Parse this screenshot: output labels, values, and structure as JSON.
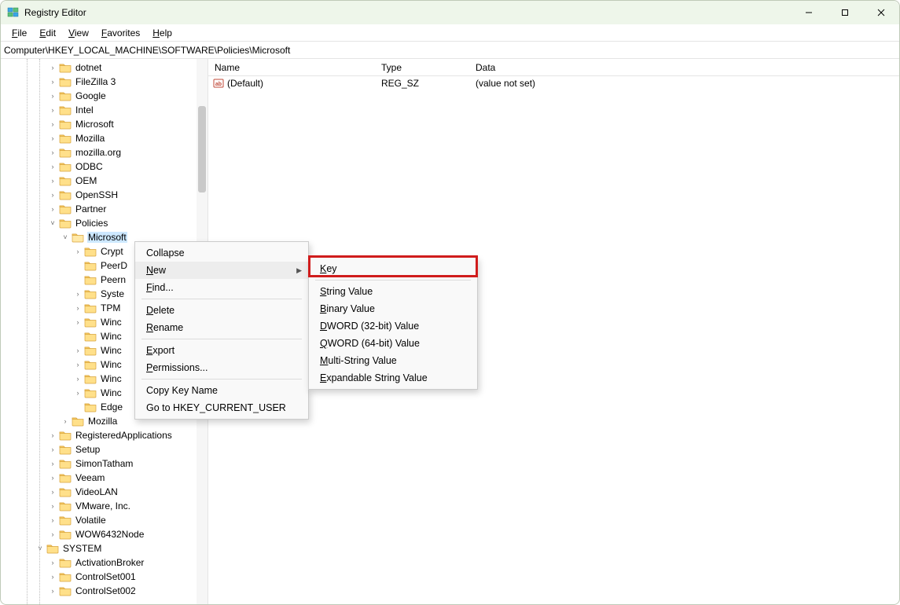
{
  "window": {
    "title": "Registry Editor"
  },
  "menubar": [
    "File",
    "Edit",
    "View",
    "Favorites",
    "Help"
  ],
  "address": "Computer\\HKEY_LOCAL_MACHINE\\SOFTWARE\\Policies\\Microsoft",
  "tree": {
    "items": [
      {
        "indent": 60,
        "chevron": ">",
        "label": "dotnet"
      },
      {
        "indent": 60,
        "chevron": ">",
        "label": "FileZilla 3"
      },
      {
        "indent": 60,
        "chevron": ">",
        "label": "Google"
      },
      {
        "indent": 60,
        "chevron": ">",
        "label": "Intel"
      },
      {
        "indent": 60,
        "chevron": ">",
        "label": "Microsoft"
      },
      {
        "indent": 60,
        "chevron": ">",
        "label": "Mozilla"
      },
      {
        "indent": 60,
        "chevron": ">",
        "label": "mozilla.org"
      },
      {
        "indent": 60,
        "chevron": ">",
        "label": "ODBC"
      },
      {
        "indent": 60,
        "chevron": ">",
        "label": "OEM"
      },
      {
        "indent": 60,
        "chevron": ">",
        "label": "OpenSSH"
      },
      {
        "indent": 60,
        "chevron": ">",
        "label": "Partner"
      },
      {
        "indent": 60,
        "chevron": "v",
        "label": "Policies"
      },
      {
        "indent": 76,
        "chevron": "v",
        "label": "Microsoft",
        "selected": true,
        "open": true
      },
      {
        "indent": 92,
        "chevron": ">",
        "label": "Crypt"
      },
      {
        "indent": 92,
        "chevron": "",
        "label": "PeerD"
      },
      {
        "indent": 92,
        "chevron": "",
        "label": "Peern"
      },
      {
        "indent": 92,
        "chevron": ">",
        "label": "Syste"
      },
      {
        "indent": 92,
        "chevron": ">",
        "label": "TPM"
      },
      {
        "indent": 92,
        "chevron": ">",
        "label": "Winc"
      },
      {
        "indent": 92,
        "chevron": "",
        "label": "Winc"
      },
      {
        "indent": 92,
        "chevron": ">",
        "label": "Winc"
      },
      {
        "indent": 92,
        "chevron": ">",
        "label": "Winc"
      },
      {
        "indent": 92,
        "chevron": ">",
        "label": "Winc"
      },
      {
        "indent": 92,
        "chevron": ">",
        "label": "Winc"
      },
      {
        "indent": 92,
        "chevron": "",
        "label": "Edge"
      },
      {
        "indent": 76,
        "chevron": ">",
        "label": "Mozilla"
      },
      {
        "indent": 60,
        "chevron": ">",
        "label": "RegisteredApplications"
      },
      {
        "indent": 60,
        "chevron": ">",
        "label": "Setup"
      },
      {
        "indent": 60,
        "chevron": ">",
        "label": "SimonTatham"
      },
      {
        "indent": 60,
        "chevron": ">",
        "label": "Veeam"
      },
      {
        "indent": 60,
        "chevron": ">",
        "label": "VideoLAN"
      },
      {
        "indent": 60,
        "chevron": ">",
        "label": "VMware, Inc."
      },
      {
        "indent": 60,
        "chevron": ">",
        "label": "Volatile"
      },
      {
        "indent": 60,
        "chevron": ">",
        "label": "WOW6432Node"
      },
      {
        "indent": 44,
        "chevron": "v",
        "label": "SYSTEM"
      },
      {
        "indent": 60,
        "chevron": ">",
        "label": "ActivationBroker"
      },
      {
        "indent": 60,
        "chevron": ">",
        "label": "ControlSet001"
      },
      {
        "indent": 60,
        "chevron": ">",
        "label": "ControlSet002"
      }
    ]
  },
  "list": {
    "headers": {
      "name": "Name",
      "type": "Type",
      "data": "Data"
    },
    "row": {
      "name": "(Default)",
      "type": "REG_SZ",
      "data": "(value not set)"
    }
  },
  "context_menu": {
    "items": [
      {
        "label": "Collapse",
        "type": "item"
      },
      {
        "label": "New",
        "type": "item",
        "arrow": true,
        "hover": true,
        "ul": "N"
      },
      {
        "label": "Find...",
        "type": "item",
        "ul": "F"
      },
      {
        "type": "sep"
      },
      {
        "label": "Delete",
        "type": "item",
        "ul": "D"
      },
      {
        "label": "Rename",
        "type": "item",
        "ul": "R"
      },
      {
        "type": "sep"
      },
      {
        "label": "Export",
        "type": "item",
        "ul": "E"
      },
      {
        "label": "Permissions...",
        "type": "item",
        "ul": "P"
      },
      {
        "type": "sep"
      },
      {
        "label": "Copy Key Name",
        "type": "item"
      },
      {
        "label": "Go to HKEY_CURRENT_USER",
        "type": "item"
      }
    ]
  },
  "sub_menu": {
    "items": [
      {
        "label": "Key",
        "ul": "K",
        "highlight": true
      },
      {
        "type": "sep"
      },
      {
        "label": "String Value",
        "ul": "S"
      },
      {
        "label": "Binary Value",
        "ul": "B"
      },
      {
        "label": "DWORD (32-bit) Value",
        "ul": "D"
      },
      {
        "label": "QWORD (64-bit) Value",
        "ul": "Q"
      },
      {
        "label": "Multi-String Value",
        "ul": "M"
      },
      {
        "label": "Expandable String Value",
        "ul": "E"
      }
    ]
  }
}
